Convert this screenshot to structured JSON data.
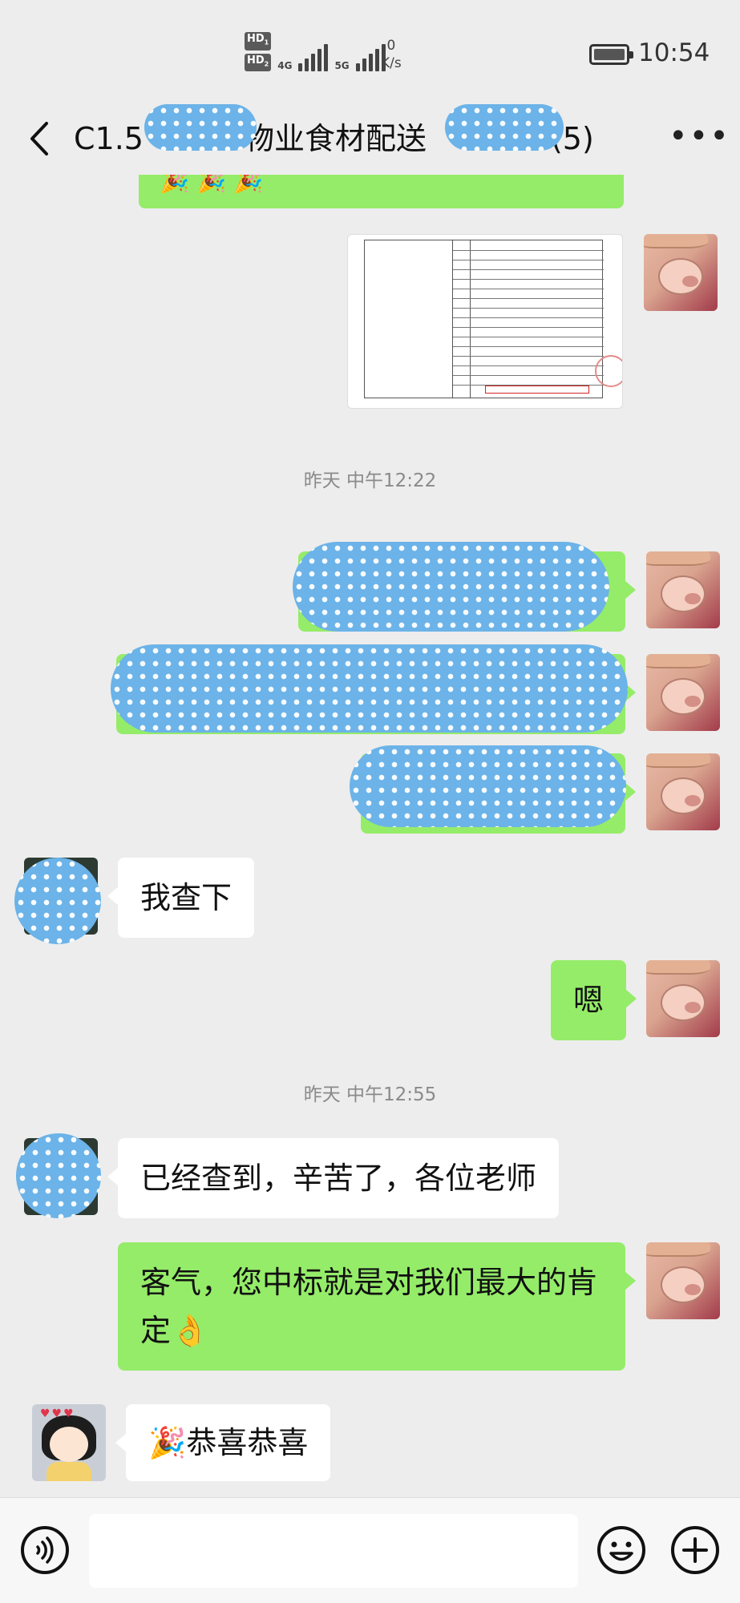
{
  "status_bar": {
    "hd_1": "HD",
    "hd_1_index": "1",
    "hd_2": "HD",
    "hd_2_index": "2",
    "network_1": "4G",
    "network_2": "5G",
    "speed_value": "0",
    "speed_unit": "K/s",
    "time": "10:54"
  },
  "header": {
    "title": "C1.5",
    "title_mid": "物业食材配送",
    "title_end": "(5)",
    "back_icon": "back-arrow-icon",
    "more_icon": "more-dots-icon",
    "more_label": "•••"
  },
  "messages": [
    {
      "type": "emoji",
      "side": "right",
      "content": "🎉🎉🎉"
    },
    {
      "type": "image",
      "side": "right",
      "description_hidden": true
    },
    {
      "type": "timestamp",
      "text": "昨天 中午12:22"
    },
    {
      "type": "text",
      "side": "right",
      "redacted": true
    },
    {
      "type": "text",
      "side": "right",
      "redacted": true
    },
    {
      "type": "text",
      "side": "right",
      "redacted": true
    },
    {
      "type": "text",
      "side": "left",
      "text": "我查下"
    },
    {
      "type": "text",
      "side": "right",
      "text": "嗯"
    },
    {
      "type": "timestamp",
      "text": "昨天 中午12:55"
    },
    {
      "type": "text",
      "side": "left",
      "text": "已经查到，辛苦了，各位老师"
    },
    {
      "type": "text",
      "side": "right",
      "line1": "客气，您中标就是对我们最大的肯",
      "line2": "定👌"
    },
    {
      "type": "text",
      "side": "left",
      "text": "🎉恭喜恭喜"
    }
  ],
  "input_bar": {
    "voice_icon": "voice-icon",
    "emoji_icon": "emoji-icon",
    "plus_icon": "plus-icon"
  },
  "colors": {
    "background": "#ededed",
    "bubble_green": "#95ec69",
    "bubble_white": "#ffffff",
    "timestamp": "#8a8a8a"
  }
}
